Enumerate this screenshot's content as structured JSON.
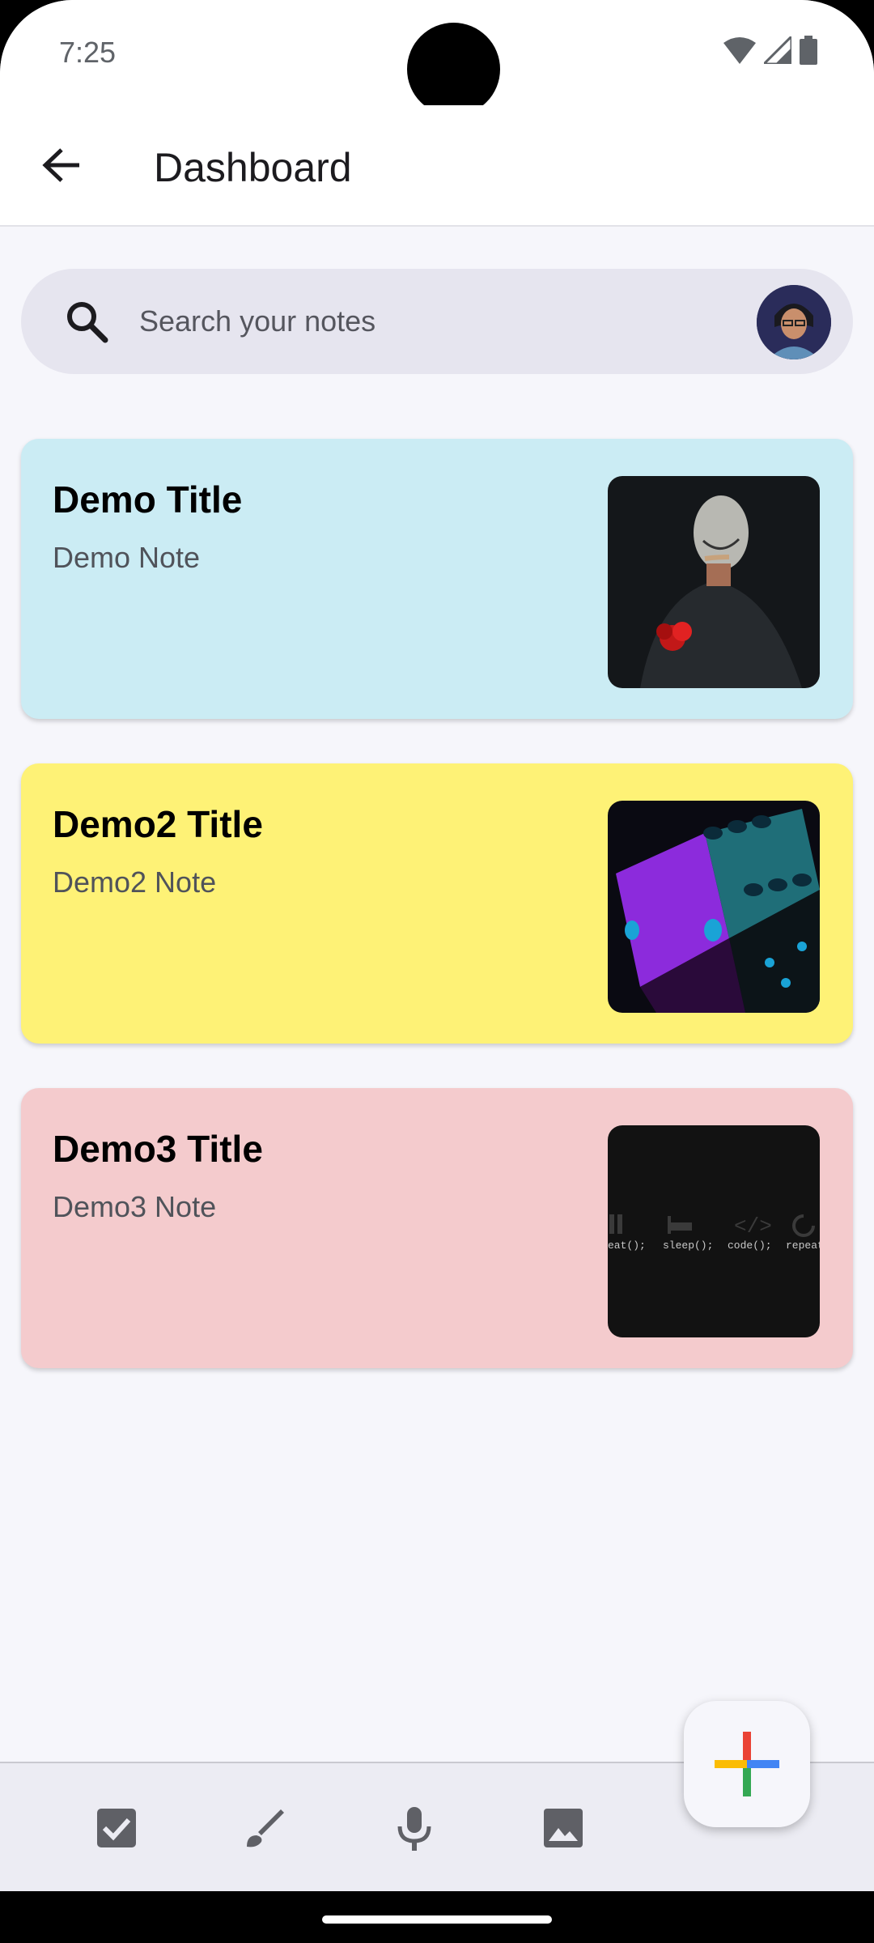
{
  "status_bar": {
    "time": "7:25"
  },
  "app_bar": {
    "title": "Dashboard"
  },
  "search": {
    "placeholder": "Search your notes"
  },
  "notes": [
    {
      "title": "Demo Title",
      "note": "Demo Note",
      "color": "#cbecf4"
    },
    {
      "title": "Demo2 Title",
      "note": "Demo2 Note",
      "color": "#fef276"
    },
    {
      "title": "Demo3 Title",
      "note": "Demo3 Note",
      "color": "#f4cbcd"
    }
  ],
  "thumb3_labels": [
    "eat();",
    "sleep();",
    "code();",
    "repeat"
  ],
  "bottom_bar": {
    "icons": [
      "checkbox-icon",
      "brush-icon",
      "mic-icon",
      "image-icon"
    ]
  },
  "fab": {
    "icon": "plus-icon"
  }
}
